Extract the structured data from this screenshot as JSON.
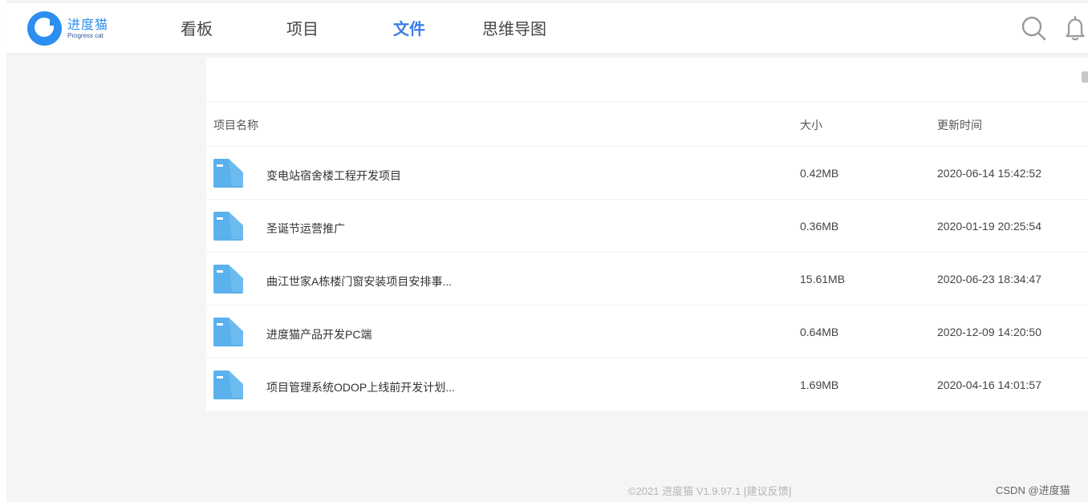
{
  "brand": {
    "name": "进度猫",
    "subtitle": "Progress cat",
    "color": "#2c8ef0"
  },
  "nav": {
    "items": [
      {
        "label": "看板",
        "active": false
      },
      {
        "label": "项目",
        "active": false
      },
      {
        "label": "文件",
        "active": true
      },
      {
        "label": "思维导图",
        "active": false
      }
    ],
    "active_color": "#3d7ee8",
    "icons": [
      "search-icon",
      "bell-icon"
    ]
  },
  "table": {
    "headers": {
      "name": "项目名称",
      "size": "大小",
      "time": "更新时间"
    },
    "rows": [
      {
        "name": "变电站宿舍楼工程开发项目",
        "size": "0.42MB",
        "time": "2020-06-14 15:42:52"
      },
      {
        "name": "圣诞节运营推广",
        "size": "0.36MB",
        "time": "2020-01-19 20:25:54"
      },
      {
        "name": "曲江世家A栋楼门窗安装项目安排事...",
        "size": "15.61MB",
        "time": "2020-06-23 18:34:47"
      },
      {
        "name": "进度猫产品开发PC端",
        "size": "0.64MB",
        "time": "2020-12-09 14:20:50"
      },
      {
        "name": "项目管理系统ODOP上线前开发计划...",
        "size": "1.69MB",
        "time": "2020-04-16 14:01:57"
      }
    ],
    "folder_color": "#5aaeea"
  },
  "footer": {
    "copyright": "©2021 进度猫 V1.9.97.1",
    "feedback": "[建议反馈]"
  },
  "watermark": "CSDN @进度猫"
}
